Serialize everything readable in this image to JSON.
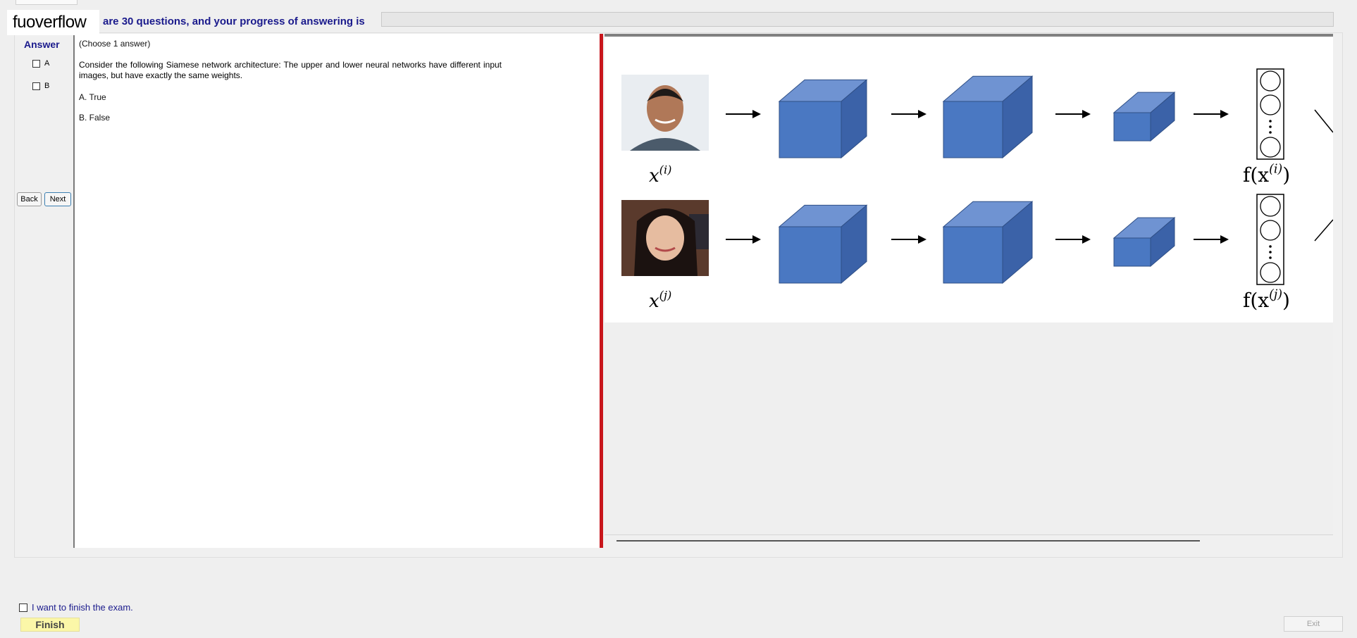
{
  "header": {
    "watermark": "fuoverflow",
    "progress_text": "are 30 questions, and your progress of answering is",
    "progress_value": 0
  },
  "answer_panel": {
    "title": "Answer",
    "options": [
      {
        "label": "A",
        "checked": false
      },
      {
        "label": "B",
        "checked": false
      }
    ],
    "back_label": "Back",
    "next_label": "Next"
  },
  "question": {
    "instruction": "(Choose 1 answer)",
    "text": "Consider the following Siamese network architecture: The upper and lower neural networks have different input images, but have exactly the same weights.",
    "choices": [
      "A.  True",
      "B.  False"
    ]
  },
  "figure": {
    "rows": [
      {
        "input_label_base": "x",
        "input_label_sup": "(i)",
        "output_label_base": "f(x",
        "output_label_sup": "(i)",
        "output_label_end": ")"
      },
      {
        "input_label_base": "x",
        "input_label_sup": "(j)",
        "output_label_base": "f(x",
        "output_label_sup": "(j)",
        "output_label_end": ")"
      }
    ],
    "colors": {
      "cube_front": "#4a78c2",
      "cube_top": "#6f93d2",
      "cube_side": "#3b62a8",
      "edge": "#2f4f86"
    }
  },
  "footer": {
    "finish_checkbox_label": "I want to finish the exam.",
    "finish_label": "Finish",
    "exit_label": "Exit"
  }
}
